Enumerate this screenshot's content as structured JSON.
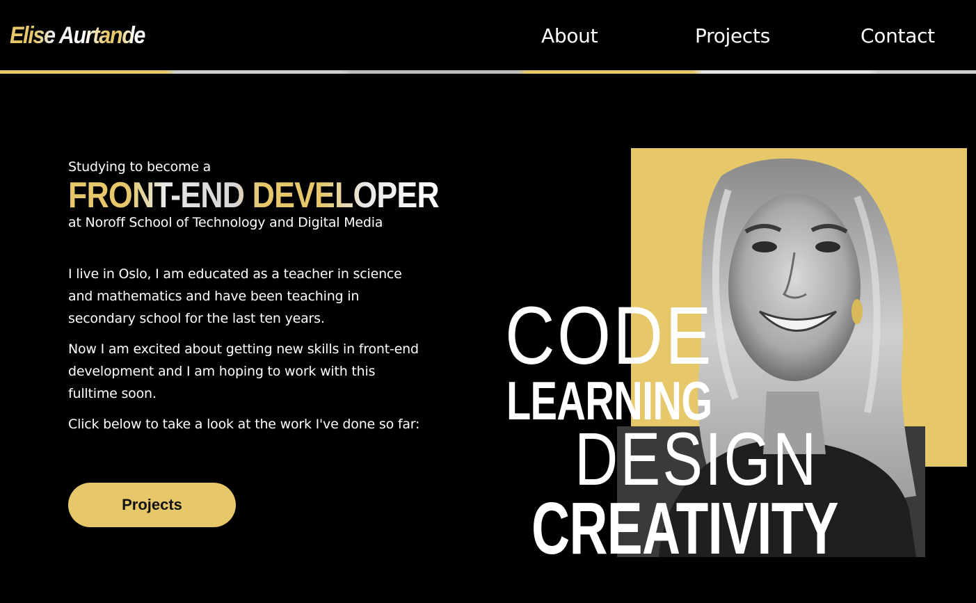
{
  "header": {
    "logo": "Elise Aurtande",
    "nav": [
      {
        "label": "About"
      },
      {
        "label": "Projects"
      },
      {
        "label": "Contact"
      }
    ]
  },
  "intro": {
    "pre": "Studying to become a",
    "title": "FRONT-END DEVELOPER",
    "school": "at Noroff School of Technology and Digital Media"
  },
  "bio": [
    "I live in Oslo, I am educated as a teacher in science and mathematics and have been teaching in secondary school for the last ten years.",
    "Now I am excited about getting new skills in front-end development and I am hoping to work with this fulltime soon.",
    "Click below to take a look at the work I've done so far:"
  ],
  "cta": {
    "label": "Projects"
  },
  "hero": {
    "words": [
      "CODE",
      "LEARNING",
      "DESIGN",
      "CREATIVITY"
    ]
  },
  "colors": {
    "accent": "#e6c76a",
    "background": "#000000",
    "text": "#ffffff"
  }
}
